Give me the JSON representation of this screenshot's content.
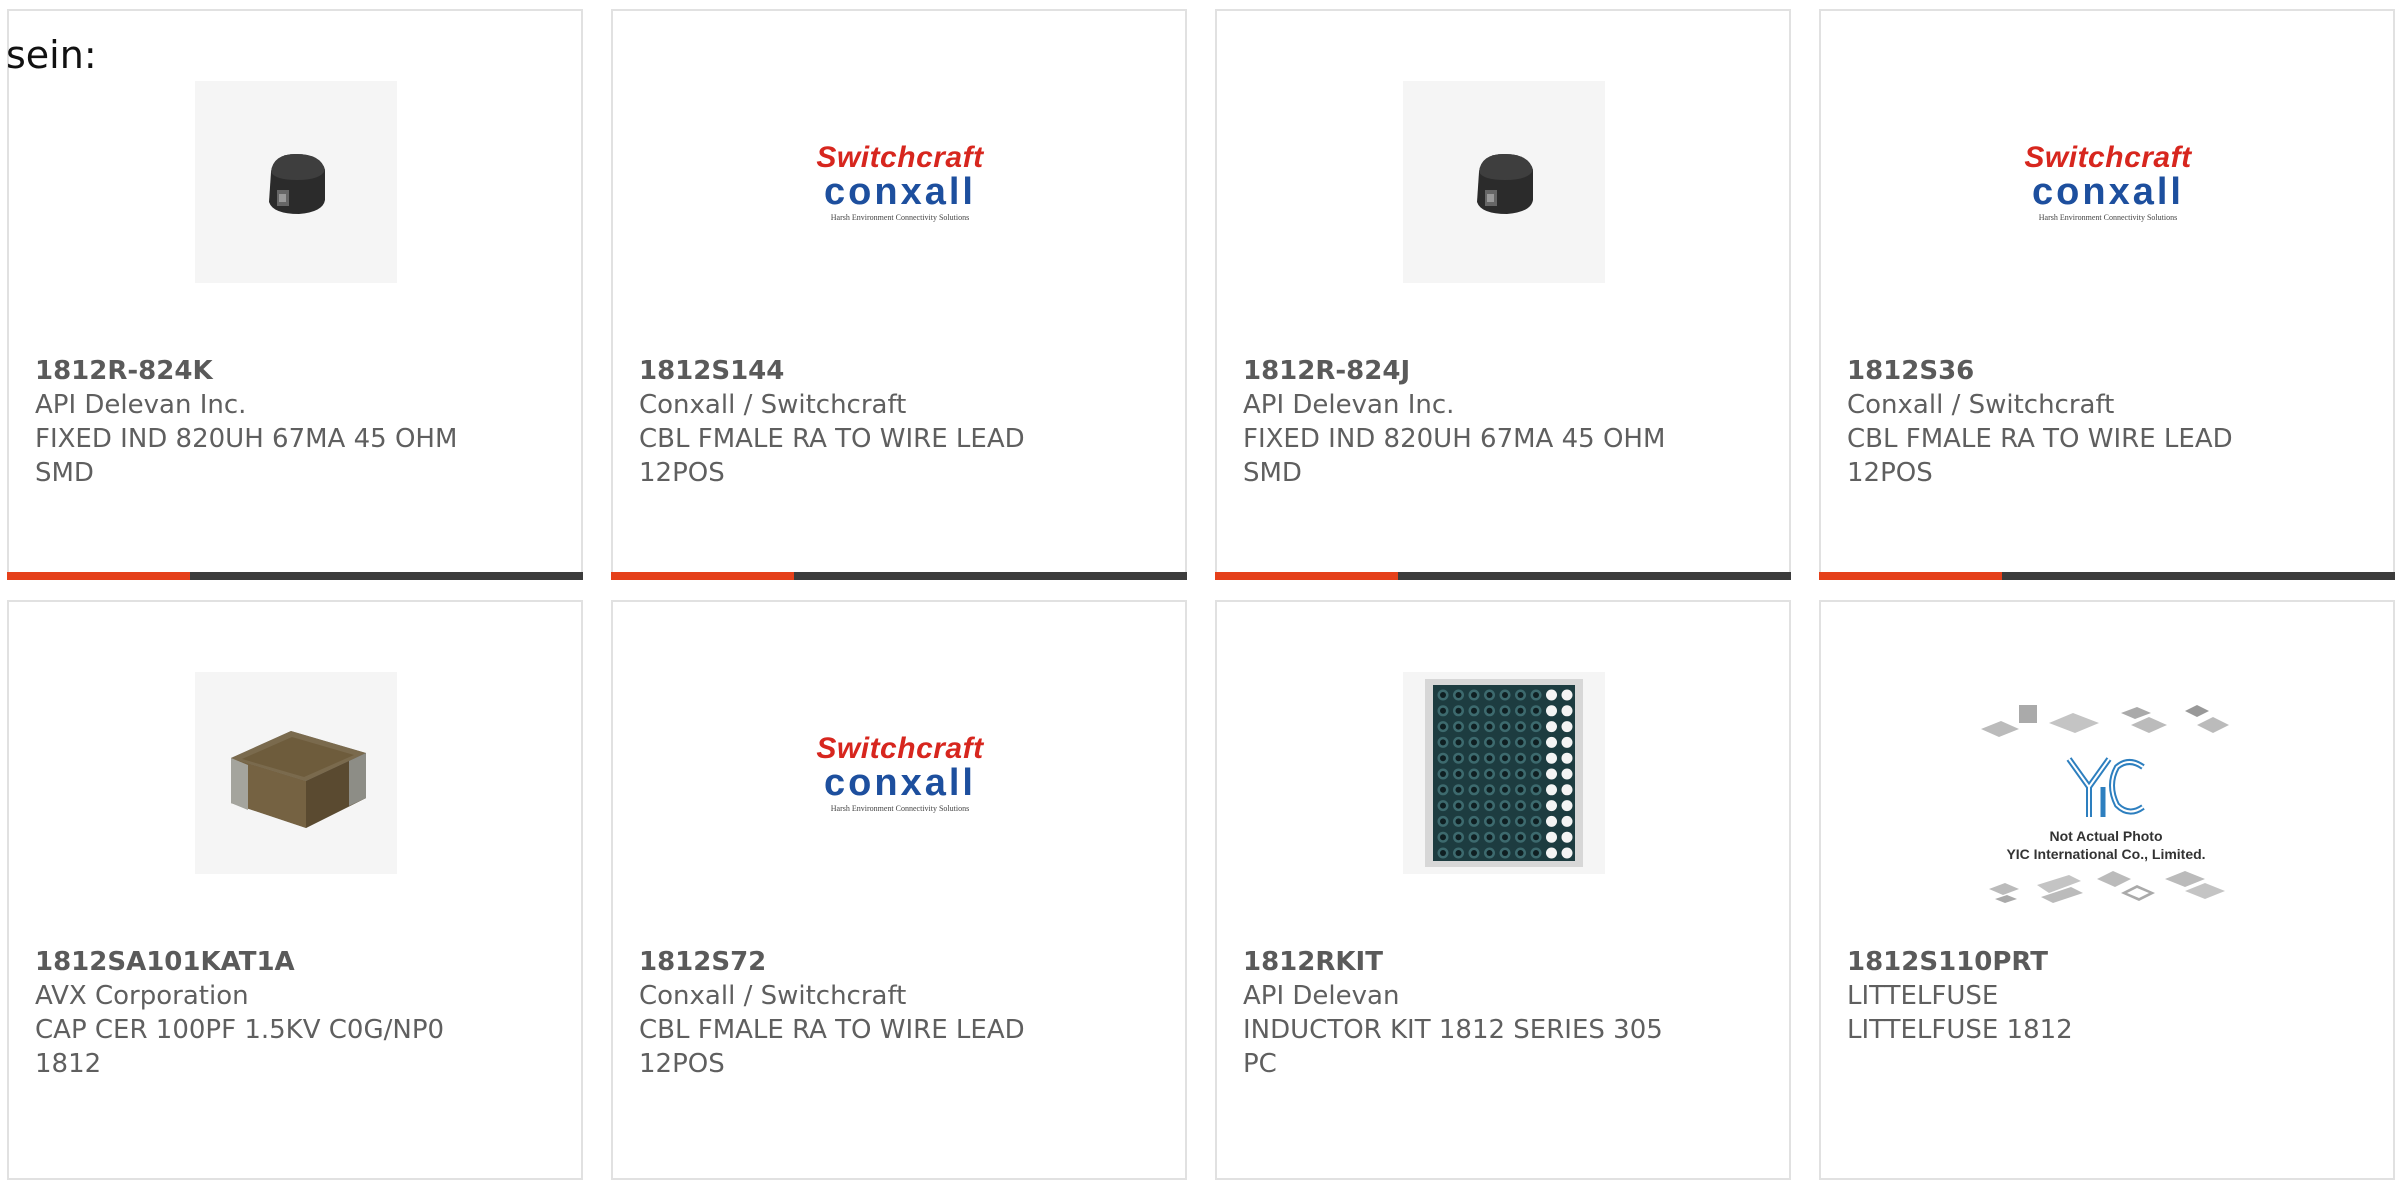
{
  "lead_text": "sein:",
  "products": [
    {
      "part": "1812R-824K",
      "maker": "API Delevan Inc.",
      "desc1": "FIXED IND 820UH 67MA 45 OHM",
      "desc2": "SMD",
      "image": "inductor-smd-icon"
    },
    {
      "part": "1812S144",
      "maker": "Conxall / Switchcraft",
      "desc1": "CBL FMALE RA TO WIRE LEAD",
      "desc2": "12POS",
      "image": "switchcraft-conxall-logo"
    },
    {
      "part": "1812R-824J",
      "maker": "API Delevan Inc.",
      "desc1": "FIXED IND 820UH 67MA 45 OHM",
      "desc2": "SMD",
      "image": "inductor-smd-icon"
    },
    {
      "part": "1812S36",
      "maker": "Conxall / Switchcraft",
      "desc1": "CBL FMALE RA TO WIRE LEAD",
      "desc2": "12POS",
      "image": "switchcraft-conxall-logo"
    },
    {
      "part": "1812SA101KAT1A",
      "maker": "AVX Corporation",
      "desc1": "CAP CER 100PF 1.5KV C0G/NP0",
      "desc2": "1812",
      "image": "ceramic-capacitor-icon"
    },
    {
      "part": "1812S72",
      "maker": "Conxall / Switchcraft",
      "desc1": "CBL FMALE RA TO WIRE LEAD",
      "desc2": "12POS",
      "image": "switchcraft-conxall-logo"
    },
    {
      "part": "1812RKIT",
      "maker": "API Delevan",
      "desc1": "INDUCTOR KIT 1812 SERIES 305",
      "desc2": "PC",
      "image": "inductor-kit-tray-icon"
    },
    {
      "part": "1812S110PRT",
      "maker": "LITTELFUSE",
      "desc1": "LITTELFUSE 1812",
      "desc2": "",
      "image": "not-actual-photo-placeholder"
    }
  ],
  "logos": {
    "switchcraft": "Switchcraft",
    "conxall": "conxall",
    "tagline": "Harsh Environment Connectivity Solutions"
  },
  "placeholder": {
    "line1": "Not Actual Photo",
    "line2": "YIC International Co., Limited."
  },
  "colors": {
    "accent": "#e5401a",
    "bar": "#3c3c3c",
    "border": "#e1e1e1",
    "text": "#5f5f5f"
  }
}
